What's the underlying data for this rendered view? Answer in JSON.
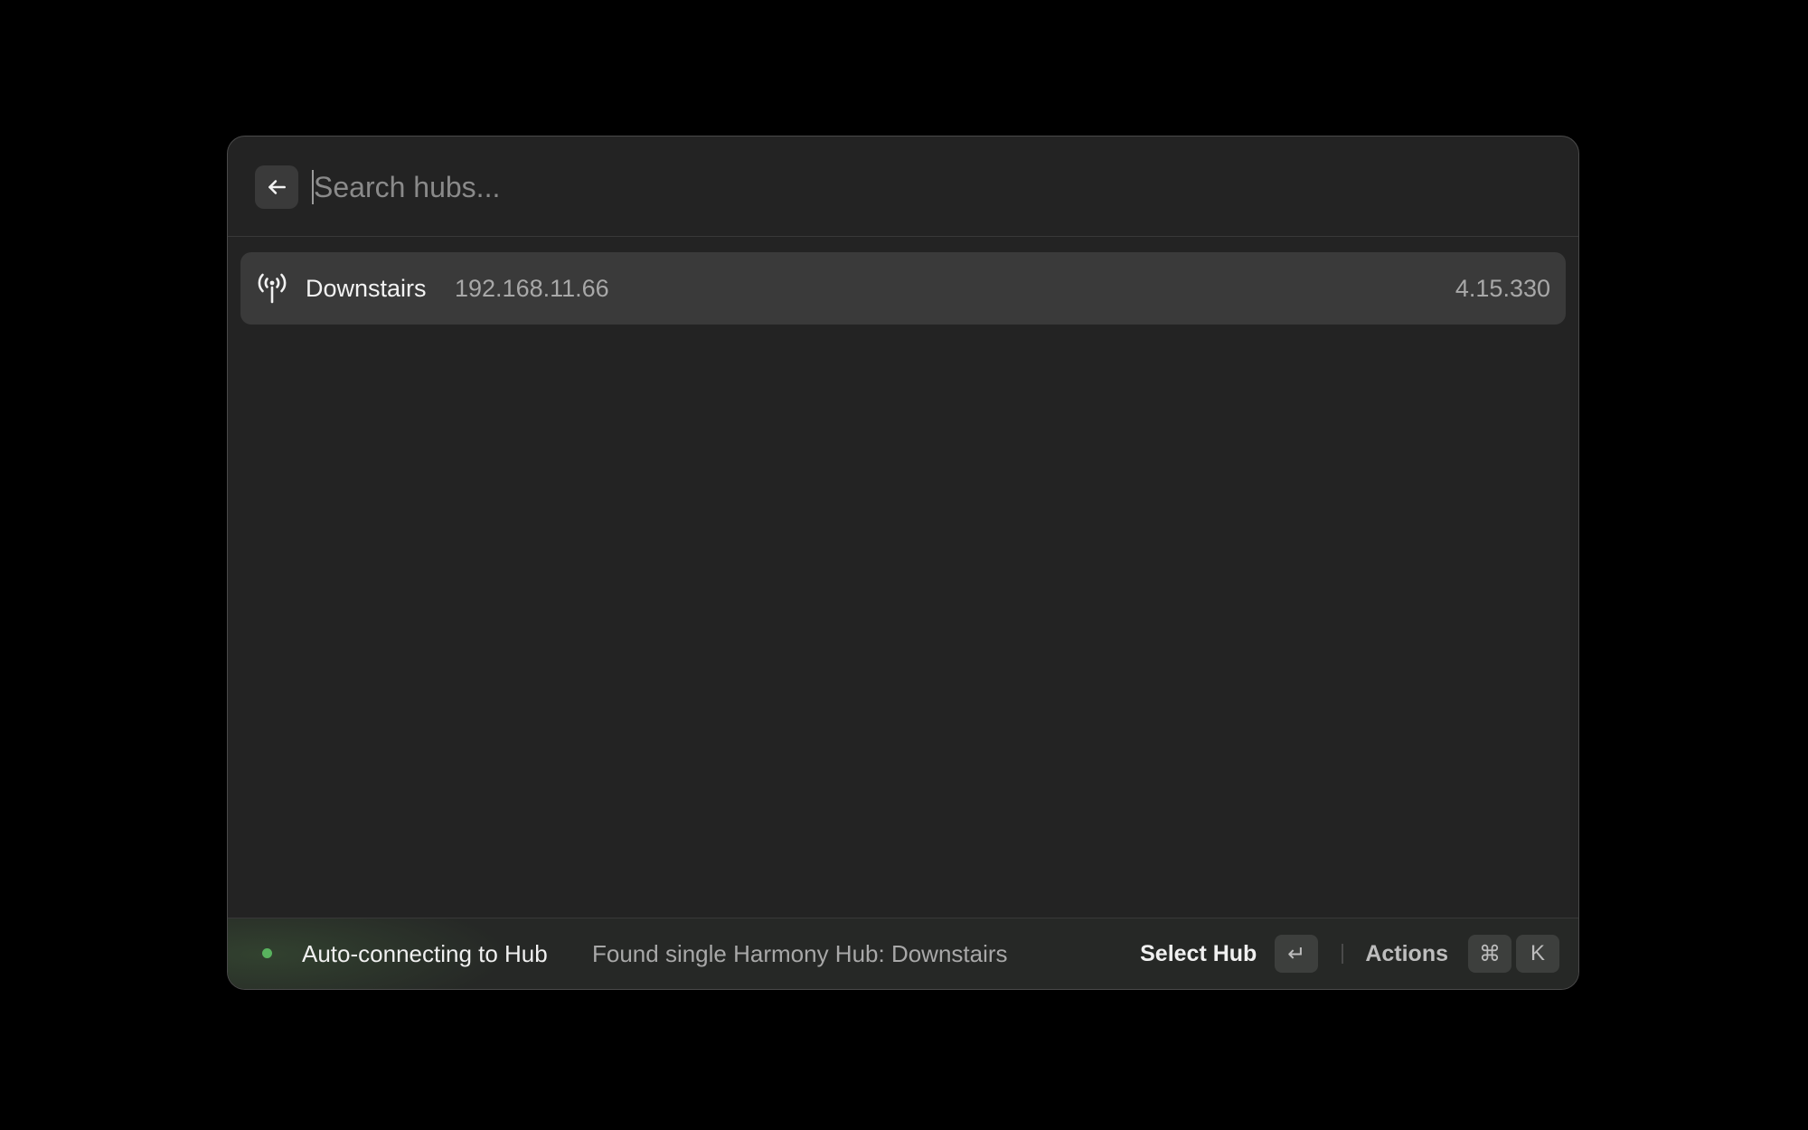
{
  "search": {
    "placeholder": "Search hubs...",
    "value": ""
  },
  "back_icon": "arrow-left-icon",
  "list": {
    "items": [
      {
        "icon": "broadcast-antenna-icon",
        "title": "Downstairs",
        "subtitle": "192.168.11.66",
        "accessory": "4.15.330",
        "selected": true
      }
    ]
  },
  "footer": {
    "status_color": "#59b35e",
    "title": "Auto-connecting to Hub",
    "message": "Found single Harmony Hub: Downstairs",
    "primary_action": "Select Hub",
    "primary_shortcut": "↵",
    "secondary_action": "Actions",
    "secondary_shortcut_keys": [
      "⌘",
      "K"
    ]
  }
}
